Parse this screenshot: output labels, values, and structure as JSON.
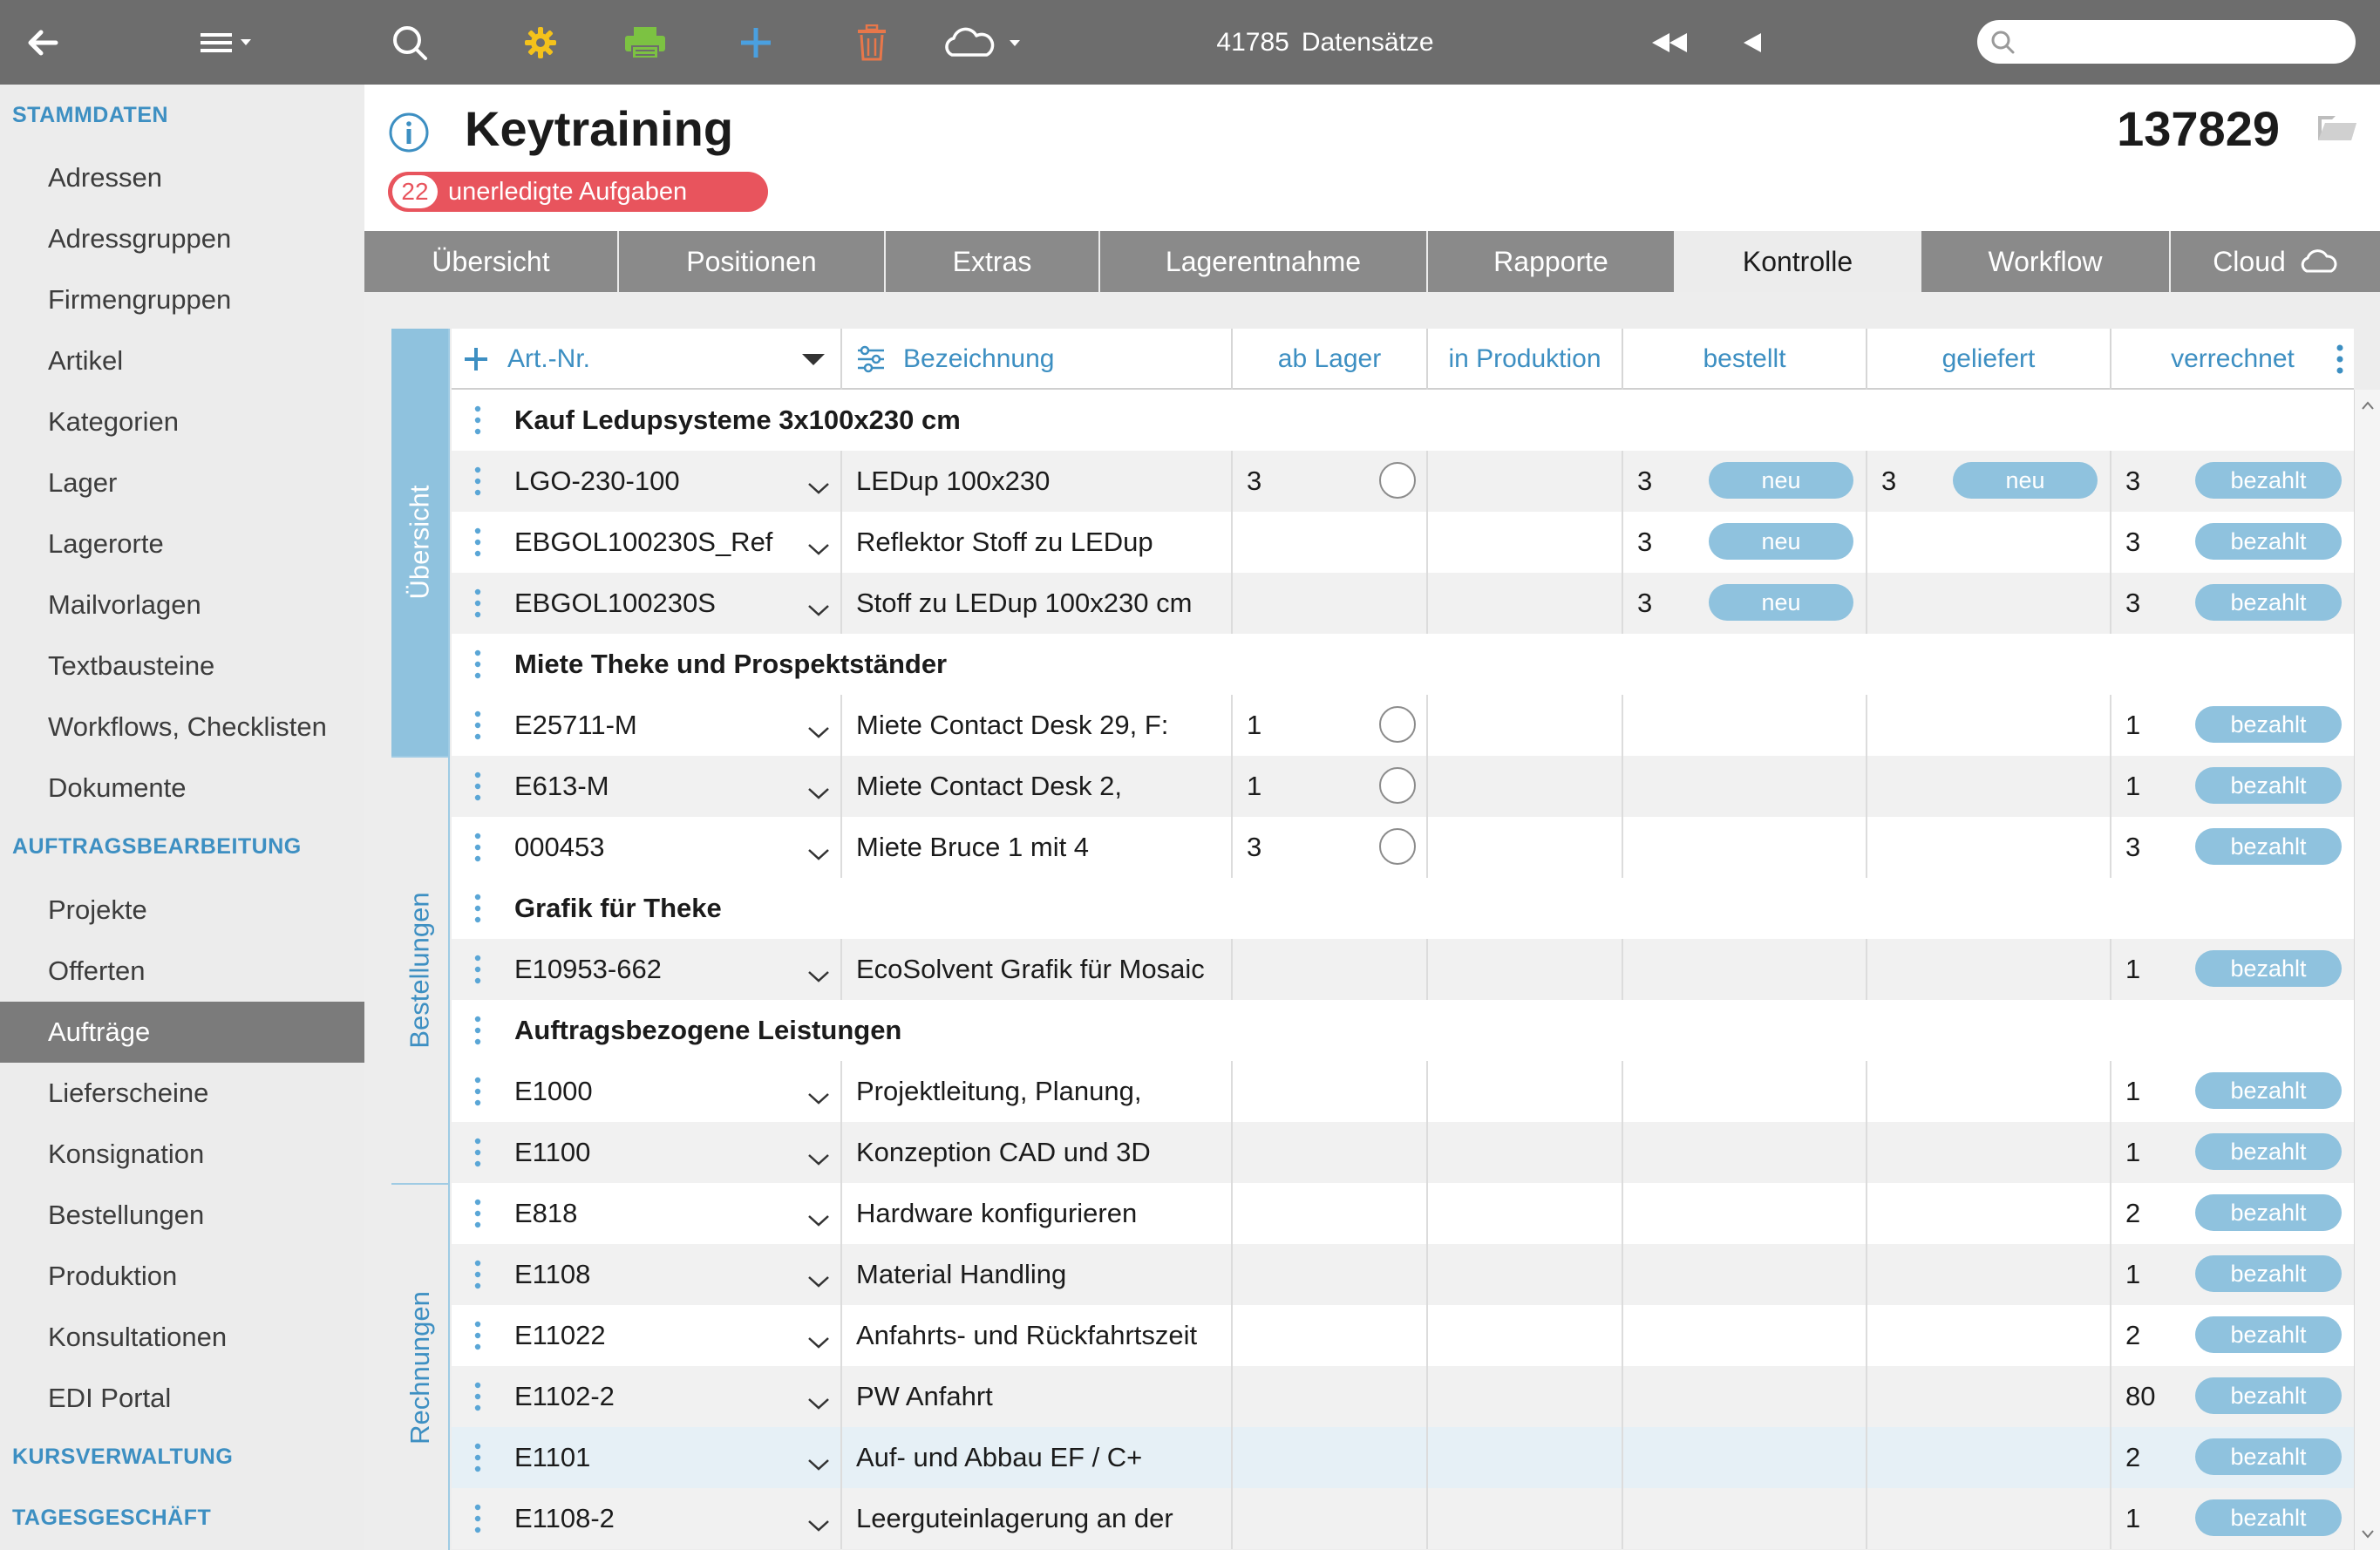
{
  "toolbar": {
    "records_count": "41785",
    "records_label": "Datensätze",
    "search_placeholder": ""
  },
  "sidebar": {
    "sections": [
      {
        "label": "STAMMDATEN",
        "items": [
          "Adressen",
          "Adressgruppen",
          "Firmengruppen",
          "Artikel",
          "Kategorien",
          "Lager",
          "Lagerorte",
          "Mailvorlagen",
          "Textbausteine",
          "Workflows, Checklisten",
          "Dokumente"
        ]
      },
      {
        "label": "AUFTRAGSBEARBEITUNG",
        "items": [
          "Projekte",
          "Offerten",
          "Aufträge",
          "Lieferscheine",
          "Konsignation",
          "Bestellungen",
          "Produktion",
          "Konsultationen",
          "EDI Portal"
        ]
      },
      {
        "label": "KURSVERWALTUNG",
        "items": []
      },
      {
        "label": "TAGESGESCHÄFT",
        "items": []
      }
    ],
    "active_item": "Aufträge"
  },
  "header": {
    "title": "Keytraining",
    "record_number": "137829",
    "open_tasks_count": "22",
    "open_tasks_label": "unerledigte Aufgaben"
  },
  "tabs": [
    "Übersicht",
    "Positionen",
    "Extras",
    "Lagerentnahme",
    "Rapporte",
    "Kontrolle",
    "Workflow",
    "Cloud"
  ],
  "active_tab": "Kontrolle",
  "vertical_tabs": [
    "Übersicht",
    "Bestellungen",
    "Rechnungen"
  ],
  "active_vertical_tab": "Übersicht",
  "columns": {
    "art_nr": "Art.-Nr.",
    "bezeichnung": "Bezeichnung",
    "ab_lager": "ab Lager",
    "in_produktion": "in Produktion",
    "bestellt": "bestellt",
    "geliefert": "geliefert",
    "verrechnet": "verrechnet"
  },
  "rows": [
    {
      "type": "group",
      "title": "Kauf Ledupsysteme 3x100x230 cm"
    },
    {
      "type": "item",
      "art_nr": "LGO-230-100",
      "bezeichnung": "LEDup 100x230",
      "ab_lager": "3",
      "lager_check": true,
      "bestellt": "3",
      "bestellt_status": "neu",
      "geliefert": "3",
      "geliefert_status": "neu",
      "verrechnet": "3",
      "verrechnet_status": "bezahlt"
    },
    {
      "type": "item",
      "art_nr": "EBGOL100230S_Ref",
      "bezeichnung": "Reflektor Stoff zu LEDup",
      "ab_lager": "",
      "lager_check": false,
      "bestellt": "3",
      "bestellt_status": "neu",
      "geliefert": "",
      "geliefert_status": "",
      "verrechnet": "3",
      "verrechnet_status": "bezahlt"
    },
    {
      "type": "item",
      "art_nr": "EBGOL100230S",
      "bezeichnung": "Stoff zu LEDup 100x230 cm",
      "ab_lager": "",
      "lager_check": false,
      "bestellt": "3",
      "bestellt_status": "neu",
      "geliefert": "",
      "geliefert_status": "",
      "verrechnet": "3",
      "verrechnet_status": "bezahlt"
    },
    {
      "type": "group",
      "title": "Miete Theke und Prospektständer"
    },
    {
      "type": "item",
      "art_nr": "E25711-M",
      "bezeichnung": "Miete Contact Desk 29, F:",
      "ab_lager": "1",
      "lager_check": true,
      "bestellt": "",
      "bestellt_status": "",
      "geliefert": "",
      "geliefert_status": "",
      "verrechnet": "1",
      "verrechnet_status": "bezahlt"
    },
    {
      "type": "item",
      "art_nr": "E613-M",
      "bezeichnung": "Miete Contact Desk 2,",
      "ab_lager": "1",
      "lager_check": true,
      "bestellt": "",
      "bestellt_status": "",
      "geliefert": "",
      "geliefert_status": "",
      "verrechnet": "1",
      "verrechnet_status": "bezahlt"
    },
    {
      "type": "item",
      "art_nr": "000453",
      "bezeichnung": "Miete Bruce 1 mit 4",
      "ab_lager": "3",
      "lager_check": true,
      "bestellt": "",
      "bestellt_status": "",
      "geliefert": "",
      "geliefert_status": "",
      "verrechnet": "3",
      "verrechnet_status": "bezahlt"
    },
    {
      "type": "group",
      "title": "Grafik für Theke"
    },
    {
      "type": "item",
      "art_nr": "E10953-662",
      "bezeichnung": "EcoSolvent Grafik für Mosaic",
      "ab_lager": "",
      "lager_check": false,
      "bestellt": "",
      "bestellt_status": "",
      "geliefert": "",
      "geliefert_status": "",
      "verrechnet": "1",
      "verrechnet_status": "bezahlt"
    },
    {
      "type": "group",
      "title": "Auftragsbezogene Leistungen"
    },
    {
      "type": "item",
      "art_nr": "E1000",
      "bezeichnung": "Projektleitung, Planung,",
      "ab_lager": "",
      "lager_check": false,
      "bestellt": "",
      "bestellt_status": "",
      "geliefert": "",
      "geliefert_status": "",
      "verrechnet": "1",
      "verrechnet_status": "bezahlt"
    },
    {
      "type": "item",
      "art_nr": "E1100",
      "bezeichnung": "Konzeption CAD und 3D",
      "ab_lager": "",
      "lager_check": false,
      "bestellt": "",
      "bestellt_status": "",
      "geliefert": "",
      "geliefert_status": "",
      "verrechnet": "1",
      "verrechnet_status": "bezahlt"
    },
    {
      "type": "item",
      "art_nr": "E818",
      "bezeichnung": "Hardware konfigurieren",
      "ab_lager": "",
      "lager_check": false,
      "bestellt": "",
      "bestellt_status": "",
      "geliefert": "",
      "geliefert_status": "",
      "verrechnet": "2",
      "verrechnet_status": "bezahlt"
    },
    {
      "type": "item",
      "art_nr": "E1108",
      "bezeichnung": "Material Handling",
      "ab_lager": "",
      "lager_check": false,
      "bestellt": "",
      "bestellt_status": "",
      "geliefert": "",
      "geliefert_status": "",
      "verrechnet": "1",
      "verrechnet_status": "bezahlt"
    },
    {
      "type": "item",
      "art_nr": "E11022",
      "bezeichnung": "Anfahrts- und Rückfahrtszeit",
      "ab_lager": "",
      "lager_check": false,
      "bestellt": "",
      "bestellt_status": "",
      "geliefert": "",
      "geliefert_status": "",
      "verrechnet": "2",
      "verrechnet_status": "bezahlt"
    },
    {
      "type": "item",
      "art_nr": "E1102-2",
      "bezeichnung": "PW Anfahrt",
      "ab_lager": "",
      "lager_check": false,
      "bestellt": "",
      "bestellt_status": "",
      "geliefert": "",
      "geliefert_status": "",
      "verrechnet": "80",
      "verrechnet_status": "bezahlt"
    },
    {
      "type": "item",
      "art_nr": "E1101",
      "bezeichnung": "Auf- und Abbau EF / C+",
      "ab_lager": "",
      "lager_check": false,
      "bestellt": "",
      "bestellt_status": "",
      "geliefert": "",
      "geliefert_status": "",
      "verrechnet": "2",
      "verrechnet_status": "bezahlt",
      "highlighted": true
    },
    {
      "type": "item",
      "art_nr": "E1108-2",
      "bezeichnung": "Leergutеinlagerung an der",
      "ab_lager": "",
      "lager_check": false,
      "bestellt": "",
      "bestellt_status": "",
      "geliefert": "",
      "geliefert_status": "",
      "verrechnet": "1",
      "verrechnet_status": "bezahlt"
    }
  ],
  "colors": {
    "toolbar_bg": "#6d6d6d",
    "accent_blue": "#3d8fc2",
    "pill_blue": "#8fc2de",
    "badge_red": "#e8545d",
    "gear_yellow": "#f4c21b",
    "print_green": "#7cc242",
    "trash_orange": "#e8774a"
  },
  "icons": [
    "back-arrow-icon",
    "list-menu-icon",
    "search-icon",
    "gear-icon",
    "printer-icon",
    "plus-icon",
    "trash-icon",
    "cloud-icon",
    "rewind-icon",
    "previous-icon",
    "info-icon",
    "folder-icon"
  ]
}
